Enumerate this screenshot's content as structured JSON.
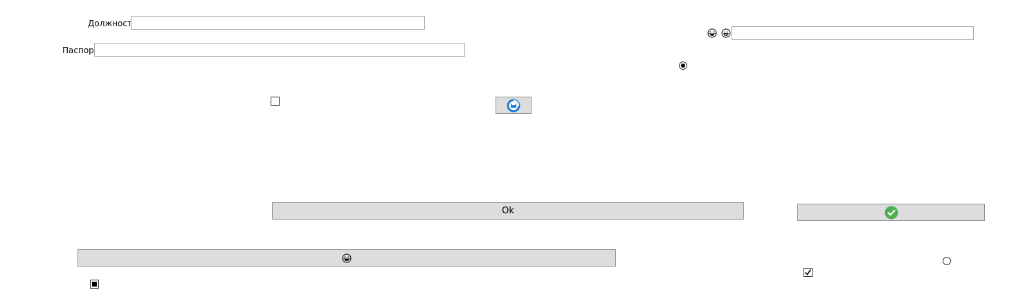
{
  "form": {
    "position_label": "Должность",
    "position_value": "",
    "passport_label": "Паспорт",
    "passport_value": "",
    "right_input_value": ""
  },
  "buttons": {
    "ok_label": "Ok",
    "save_icon": "saving-disk-icon",
    "confirm_icon": "green-check-circle-icon",
    "emoji_button_icon": "laughing-face-icon"
  },
  "icons": {
    "right_input_prefix": [
      "laughing-face-icon",
      "grinning-face-icon"
    ]
  },
  "controls": {
    "radio_top_checked": true,
    "radio_bottom_checked": false,
    "checkbox_top_checked": false,
    "checkbox_right_checked": true,
    "checkbox_bottom_left_state": "indeterminate"
  },
  "colors": {
    "button_bg": "#dddddd",
    "button_border": "#8f8f8f",
    "input_border": "#a8a8a8",
    "accent_green": "#4caf50",
    "accent_blue": "#1e7bd6"
  }
}
